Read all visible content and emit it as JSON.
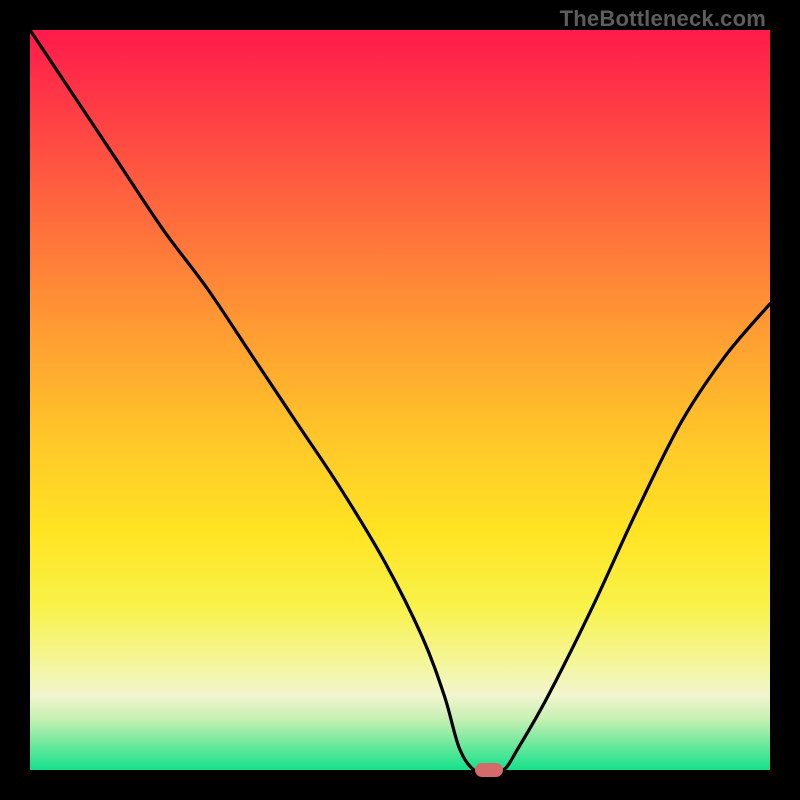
{
  "watermark": "TheBottleneck.com",
  "colors": {
    "bg_black": "#000000",
    "curve": "#000000",
    "marker": "#d46a6a",
    "gradient_stops": [
      {
        "offset": 0.0,
        "color": "#ff1a4b"
      },
      {
        "offset": 0.1,
        "color": "#ff3a46"
      },
      {
        "offset": 0.25,
        "color": "#ff6a3d"
      },
      {
        "offset": 0.4,
        "color": "#ff9a33"
      },
      {
        "offset": 0.55,
        "color": "#ffc629"
      },
      {
        "offset": 0.68,
        "color": "#ffe423"
      },
      {
        "offset": 0.78,
        "color": "#f8f24a"
      },
      {
        "offset": 0.86,
        "color": "#f4f6a0"
      },
      {
        "offset": 0.9,
        "color": "#f0f5cf"
      },
      {
        "offset": 0.93,
        "color": "#c9f0b4"
      },
      {
        "offset": 0.96,
        "color": "#7be9a0"
      },
      {
        "offset": 1.0,
        "color": "#14e18b"
      }
    ]
  },
  "chart_data": {
    "type": "line",
    "title": "",
    "xlabel": "",
    "ylabel": "",
    "xlim": [
      0,
      100
    ],
    "ylim": [
      0,
      100
    ],
    "grid": false,
    "series": [
      {
        "name": "bottleneck-curve",
        "x": [
          0,
          6,
          12,
          18,
          24,
          30,
          36,
          42,
          48,
          53,
          56,
          58,
          60,
          62,
          64,
          66,
          70,
          76,
          82,
          88,
          94,
          100
        ],
        "y": [
          100,
          91,
          82,
          73,
          65,
          56,
          47,
          38,
          28,
          18,
          10,
          3,
          0,
          0,
          0,
          3,
          10,
          22,
          35,
          47,
          56,
          63
        ]
      }
    ],
    "marker": {
      "x": 62,
      "y": 0
    },
    "annotations": [
      {
        "text": "TheBottleneck.com",
        "position": "top-right"
      }
    ]
  }
}
